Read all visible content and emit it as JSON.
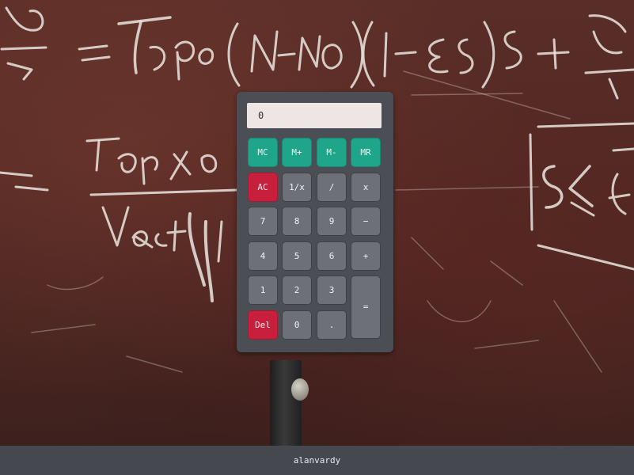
{
  "display": {
    "value": "0"
  },
  "keys": {
    "mc": "MC",
    "m_plus": "M+",
    "m_minus": "M-",
    "mr": "MR",
    "ac": "AC",
    "reciprocal": "1/x",
    "divide": "/",
    "multiply": "x",
    "seven": "7",
    "eight": "8",
    "nine": "9",
    "minus": "−",
    "four": "4",
    "five": "5",
    "six": "6",
    "plus": "+",
    "one": "1",
    "two": "2",
    "three": "3",
    "equals": "=",
    "del": "Del",
    "zero": "0",
    "dot": "."
  },
  "footer": {
    "author": "alanvardy"
  },
  "colors": {
    "memory_key": "#1fa68a",
    "clear_key": "#c8203c",
    "standard_key": "#6e7078",
    "body": "#4b4e54",
    "display_bg": "#ede6e4"
  }
}
